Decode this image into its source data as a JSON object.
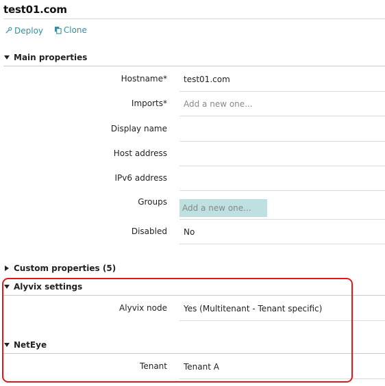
{
  "page": {
    "title": "test01.com"
  },
  "actions": {
    "deploy": "Deploy",
    "clone": "Clone"
  },
  "main_properties": {
    "heading": "Main properties",
    "fields": [
      {
        "label": "Hostname*",
        "value": "test01.com",
        "placeholder": ""
      },
      {
        "label": "Imports*",
        "value": "",
        "placeholder": "Add a new one..."
      },
      {
        "label": "Display name",
        "value": "",
        "placeholder": ""
      },
      {
        "label": "Host address",
        "value": "",
        "placeholder": ""
      },
      {
        "label": "IPv6 address",
        "value": "",
        "placeholder": ""
      },
      {
        "label": "Groups",
        "value": "",
        "placeholder": "Add a new one..."
      },
      {
        "label": "Disabled",
        "value": "No",
        "placeholder": ""
      }
    ]
  },
  "custom_properties": {
    "heading": "Custom properties (5)"
  },
  "alyvix_settings": {
    "heading": "Alyvix settings",
    "field": {
      "label": "Alyvix node",
      "value": "Yes (Multitenant - Tenant specific)"
    }
  },
  "neteye": {
    "heading": "NetEye",
    "field": {
      "label": "Tenant",
      "value": "Tenant A"
    }
  },
  "colors": {
    "accent": "#3a8d9a",
    "highlight_border": "#e0161b",
    "groups_fill": "#bfe0e0"
  },
  "icons": {
    "deploy": "wrench-icon",
    "clone": "copy-icon",
    "expanded": "caret-down-icon",
    "collapsed": "caret-right-icon"
  }
}
